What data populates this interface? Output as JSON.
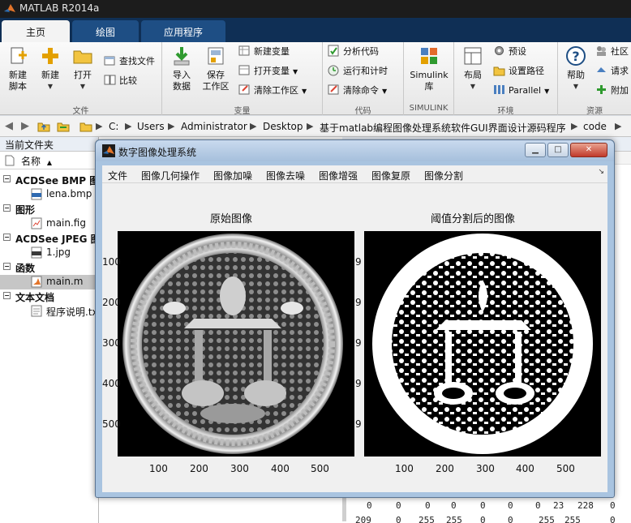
{
  "app": {
    "title": "MATLAB R2014a",
    "tabs": [
      {
        "label": "主页",
        "active": true
      },
      {
        "label": "绘图",
        "active": false
      },
      {
        "label": "应用程序",
        "active": false
      }
    ]
  },
  "ribbon": {
    "file_group": {
      "label": "文件",
      "new_script": "新建\n脚本",
      "new": "新建",
      "open": "打开",
      "find_files": "查找文件",
      "compare": "比较"
    },
    "variable_group": {
      "label": "变量",
      "import": "导入\n数据",
      "save_ws": "保存\n工作区",
      "new_var": "新建变量",
      "open_var": "打开变量",
      "clear_ws": "清除工作区"
    },
    "code_group": {
      "label": "代码",
      "analyze": "分析代码",
      "run_time": "运行和计时",
      "clear_cmd": "清除命令"
    },
    "simulink_group": {
      "label": "SIMULINK",
      "lib": "Simulink\n库"
    },
    "env_group": {
      "label": "环境",
      "layout": "布局",
      "prefs": "预设",
      "set_path": "设置路径",
      "parallel": "Parallel"
    },
    "resources_group": {
      "label": "资源",
      "help": "帮助",
      "community": "社区",
      "request": "请求",
      "addons": "附加"
    }
  },
  "address_bar": {
    "crumbs": [
      "C:",
      "Users",
      "Administrator",
      "Desktop",
      "基于matlab编程图像处理系统软件GUI界面设计源码程序",
      "code"
    ]
  },
  "folder_panel": {
    "title": "当前文件夹",
    "column_header": "名称",
    "sort_arrow": "▲",
    "groups": [
      {
        "label": "ACDSee BMP 图",
        "files": [
          {
            "name": "lena.bmp",
            "icon": "bmp-icon"
          }
        ]
      },
      {
        "label": "图形",
        "files": [
          {
            "name": "main.fig",
            "icon": "fig-icon"
          }
        ]
      },
      {
        "label": "ACDSee JPEG 图",
        "files": [
          {
            "name": "1.jpg",
            "icon": "jpg-icon"
          }
        ]
      },
      {
        "label": "函数",
        "files": [
          {
            "name": "main.m",
            "icon": "m-file-icon",
            "selected": true
          }
        ]
      },
      {
        "label": "文本文档",
        "files": [
          {
            "name": "程序说明.txt",
            "icon": "txt-icon"
          }
        ]
      }
    ]
  },
  "workspace_peek": {
    "row1": [
      "0",
      "0",
      "0",
      "0",
      "0",
      "0",
      "0",
      "23",
      "228",
      "0"
    ],
    "row2": [
      "209",
      "0",
      "255",
      "255",
      "0",
      "0",
      "255",
      "255",
      "0"
    ]
  },
  "gui": {
    "title": "数字图像处理系统",
    "menus": [
      "文件",
      "图像几何操作",
      "图像加噪",
      "图像去噪",
      "图像增强",
      "图像复原",
      "图像分割"
    ],
    "left_axes": {
      "title": "原始图像",
      "xticks": [
        "100",
        "200",
        "300",
        "400",
        "500"
      ],
      "yticks": [
        "100",
        "200",
        "300",
        "400",
        "500"
      ]
    },
    "right_axes": {
      "title": "阈值分割后的图像",
      "xticks": [
        "100",
        "200",
        "300",
        "400",
        "500"
      ]
    }
  },
  "colors": {
    "ribbon_dark": "#0f2f55",
    "tab_blue": "#1e4e84",
    "window_frame": "#a9c4e0"
  }
}
